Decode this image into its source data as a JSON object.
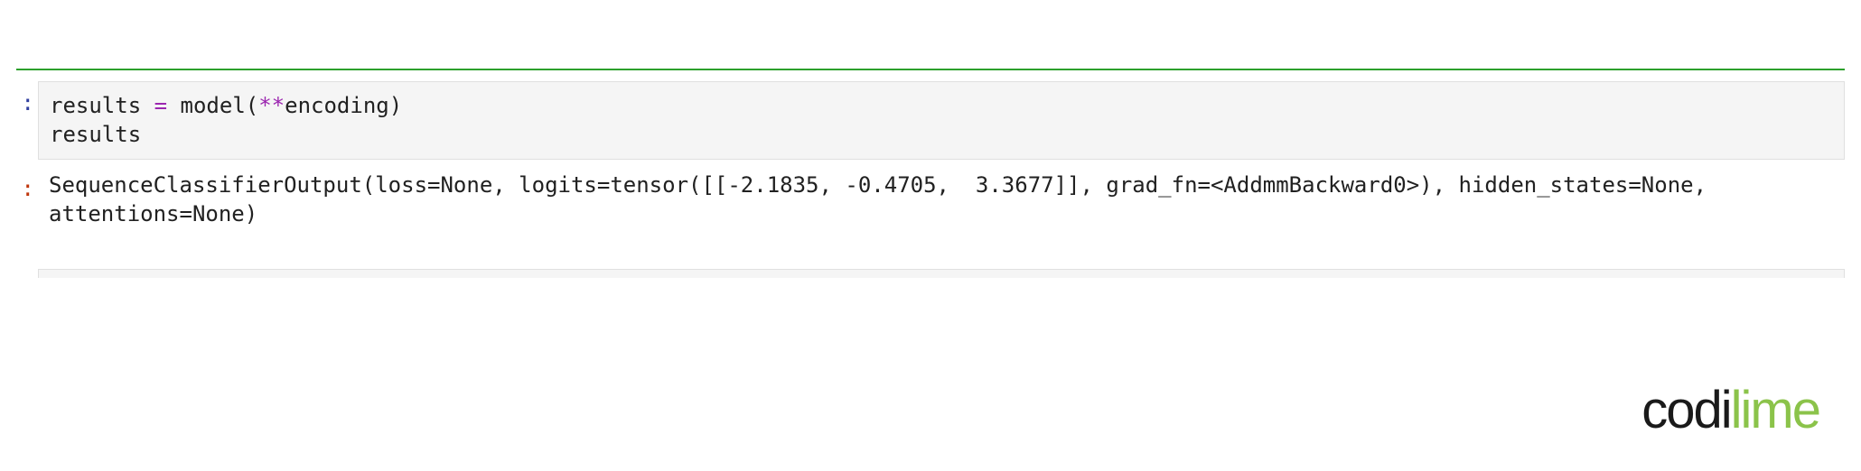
{
  "code": {
    "line1": {
      "var1": "results",
      "eq": " = ",
      "func": "model",
      "lparen": "(",
      "stars": "**",
      "arg": "encoding",
      "rparen": ")"
    },
    "line2": "results"
  },
  "output": {
    "text": "SequenceClassifierOutput(loss=None, logits=tensor([[-2.1835, -0.4705,  3.3677]], grad_fn=<AddmmBackward0>), hidden_states=None, attentions=None)"
  },
  "prompts": {
    "in": ":",
    "out": ":"
  },
  "logo": {
    "part1": "codi",
    "part2": "lime"
  }
}
